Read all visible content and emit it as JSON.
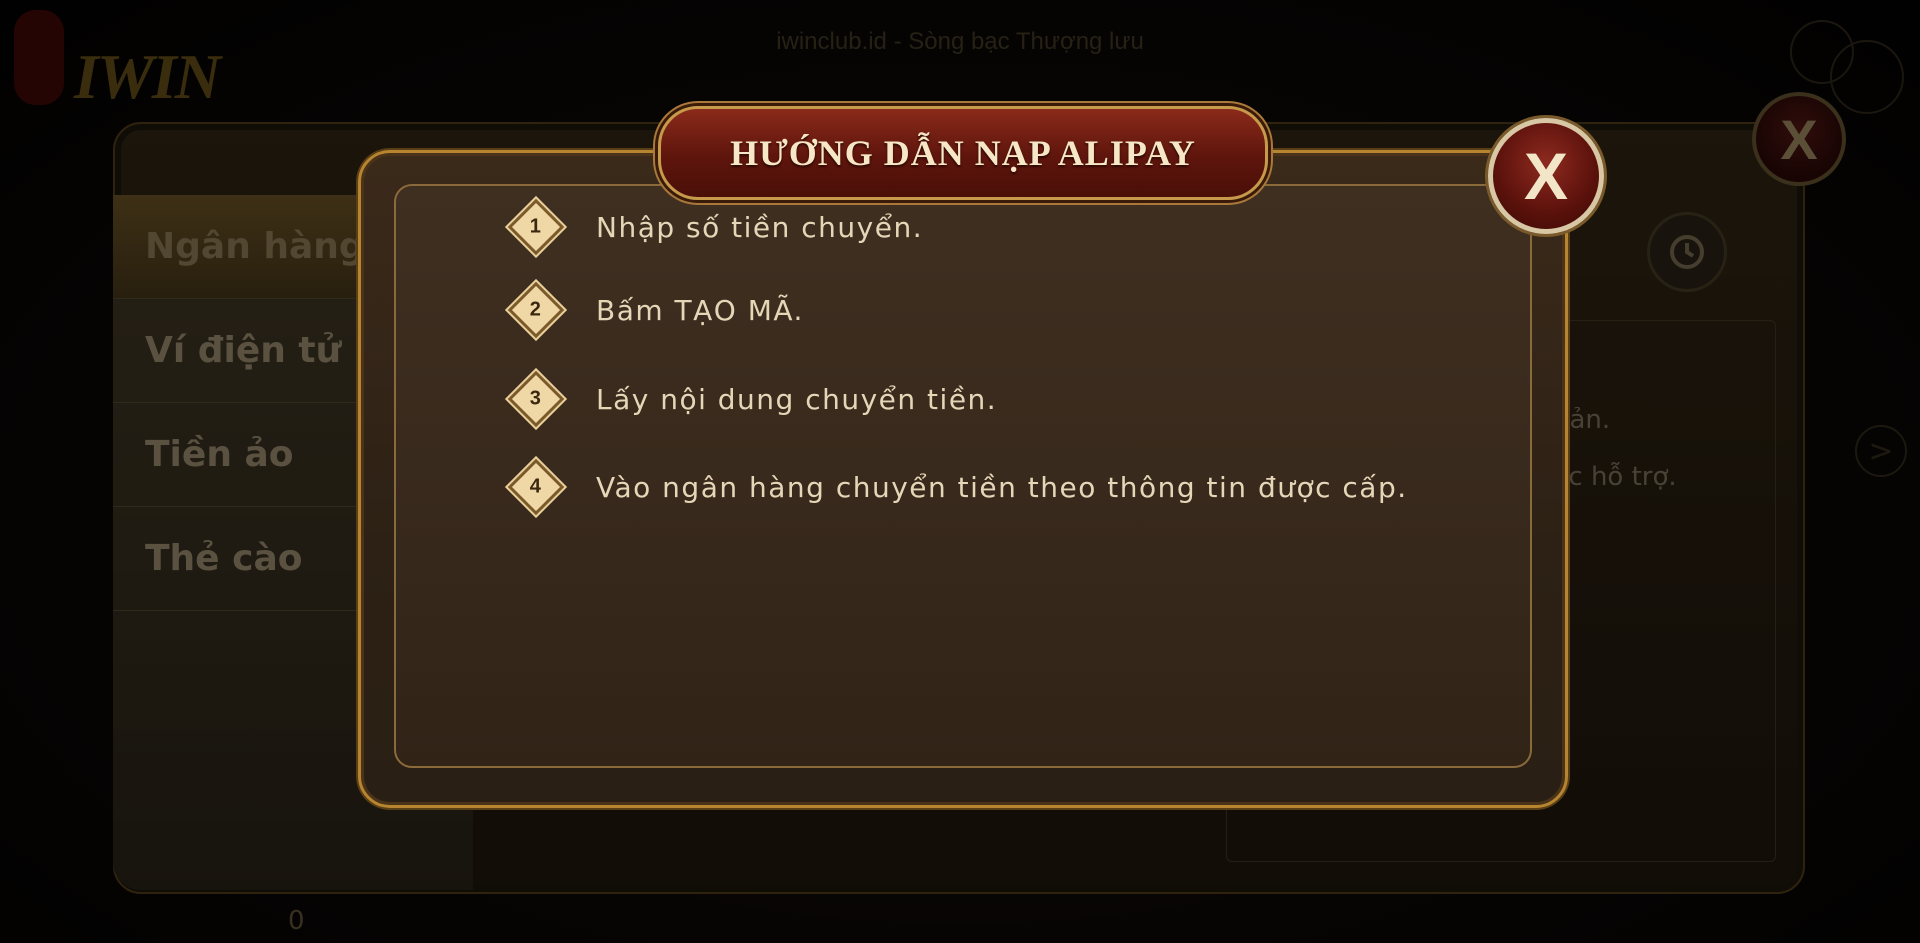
{
  "site_title": "iwinclub.id - Sòng bạc Thượng lưu",
  "logo_text": "IWIN",
  "sidebar": {
    "items": [
      {
        "label": "Ngân hàng"
      },
      {
        "label": "Ví điện tử"
      },
      {
        "label": "Tiền ảo"
      },
      {
        "label": "Thẻ cào"
      }
    ]
  },
  "back_panel": {
    "close_label": "X",
    "info_lines": [
      "khoản.",
      "ược hỗ trợ."
    ],
    "balance": "0",
    "next_arrow": ">"
  },
  "dialog": {
    "title": "HƯỚNG DẪN NẠP ALIPAY",
    "close_label": "X",
    "steps": [
      {
        "number": "1",
        "text": "Nhập số tiền chuyển."
      },
      {
        "number": "2",
        "text": "Bấm TẠO MÃ."
      },
      {
        "number": "3",
        "text": "Lấy nội dung chuyển tiền."
      },
      {
        "number": "4",
        "text": "Vào ngân hàng chuyển tiền theo thông tin được cấp."
      }
    ]
  },
  "icons": {
    "history": "history-icon",
    "close": "close-icon"
  },
  "colors": {
    "accent_gold": "#b7852f",
    "title_red": "#5e150c",
    "text_cream": "#e6d6b8"
  }
}
